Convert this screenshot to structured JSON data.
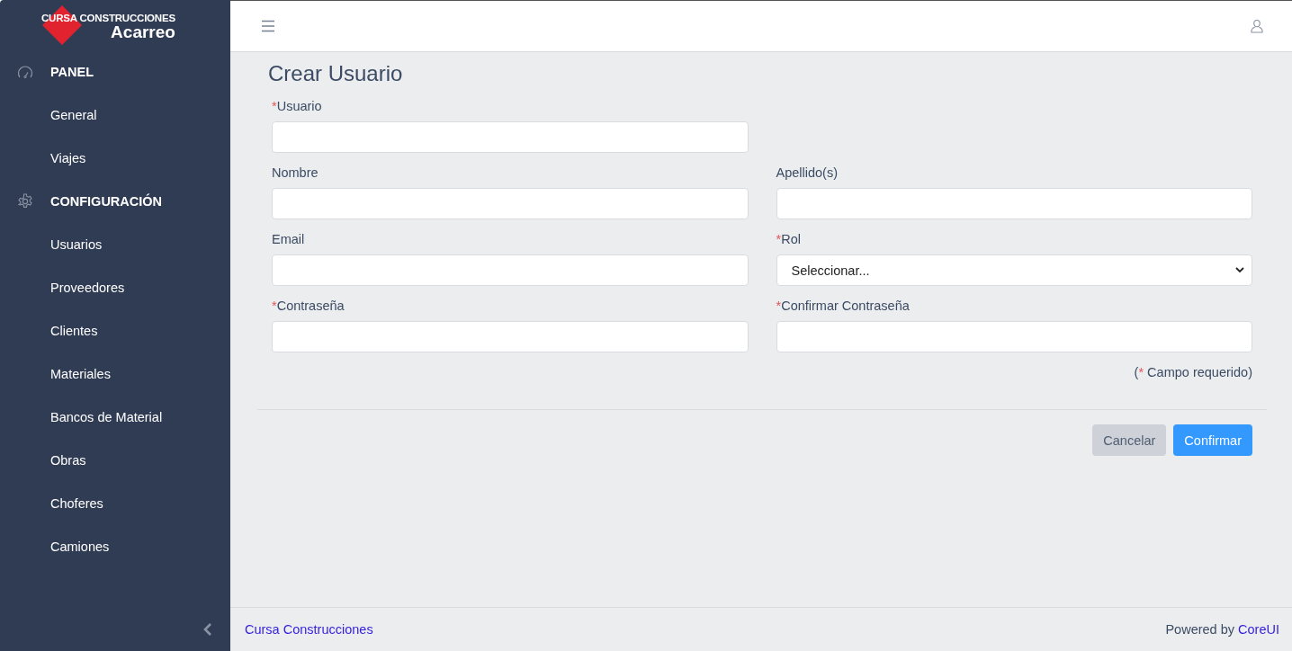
{
  "logo": {
    "brand": "CURSA CONSTRUCCIONES",
    "product": "Acarreo"
  },
  "sidebar": {
    "sections": [
      {
        "title": "PANEL",
        "items": [
          {
            "label": "General"
          },
          {
            "label": "Viajes"
          }
        ]
      },
      {
        "title": "CONFIGURACIÓN",
        "items": [
          {
            "label": "Usuarios"
          },
          {
            "label": "Proveedores"
          },
          {
            "label": "Clientes"
          },
          {
            "label": "Materiales"
          },
          {
            "label": "Bancos de Material"
          },
          {
            "label": "Obras"
          },
          {
            "label": "Choferes"
          },
          {
            "label": "Camiones"
          }
        ]
      }
    ]
  },
  "page_title": "Crear Usuario",
  "form": {
    "rows": [
      [
        {
          "kind": "text",
          "label": "Usuario",
          "mark": "*"
        }
      ],
      [
        {
          "kind": "text",
          "label": "Nombre"
        },
        {
          "kind": "text",
          "label": "Apellido(s)"
        }
      ],
      [
        {
          "kind": "text",
          "label": "Email"
        },
        {
          "kind": "select",
          "label": "Rol",
          "mark": "*",
          "value": "Seleccionar..."
        }
      ],
      [
        {
          "kind": "password",
          "label": "Contraseña",
          "mark": "*"
        },
        {
          "kind": "password",
          "label": "Confirmar Contraseña",
          "mark": "*"
        }
      ]
    ],
    "note": {
      "prefix": "(",
      "mark": "*",
      "text": "Campo requerido)"
    },
    "buttons": [
      {
        "label": "Cancelar",
        "kind": "secondary"
      },
      {
        "label": "Confirmar",
        "kind": "primary"
      }
    ]
  },
  "footer": {
    "left": "Cursa Construcciones",
    "powered": "Powered by",
    "link": "CoreUI"
  }
}
